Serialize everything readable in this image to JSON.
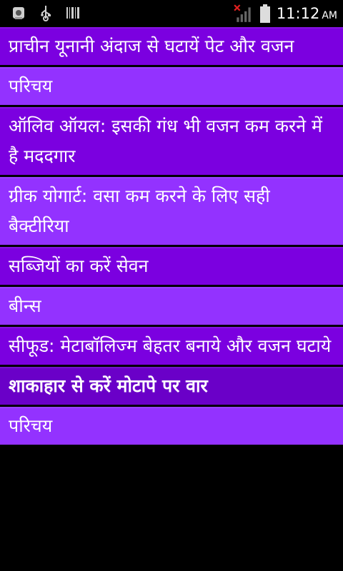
{
  "status_bar": {
    "time": "11:12",
    "ampm": "AM",
    "icons": [
      "android-debug-icon",
      "usb-icon",
      "barcode-icon",
      "no-signal-icon",
      "battery-icon"
    ]
  },
  "colors": {
    "item_dark": "#7b00e0",
    "item_light": "#9332ff",
    "header": "#6a00c8",
    "text": "#ffffff"
  },
  "list": {
    "items": [
      {
        "label": "प्राचीन यूनानी अंदाज से घटायें पेट और वजन",
        "style": "dark"
      },
      {
        "label": "परिचय",
        "style": "light"
      },
      {
        "label": "ऑलिव ऑयल: इसकी गंध भी वजन कम करने में है मददगार",
        "style": "dark"
      },
      {
        "label": "ग्रीक योगार्ट: वसा कम करने के लिए सही बैक्टीरिया",
        "style": "light"
      },
      {
        "label": "सब्जियों का करें सेवन",
        "style": "dark"
      },
      {
        "label": "बीन्स",
        "style": "light"
      },
      {
        "label": "सीफूड: मेटाबॉलिज्म बेहतर बनाये और वजन घटाये",
        "style": "dark"
      },
      {
        "label": "शाकाहार से करें मोटापे पर वार",
        "style": "header"
      },
      {
        "label": "परिचय",
        "style": "light"
      }
    ]
  }
}
